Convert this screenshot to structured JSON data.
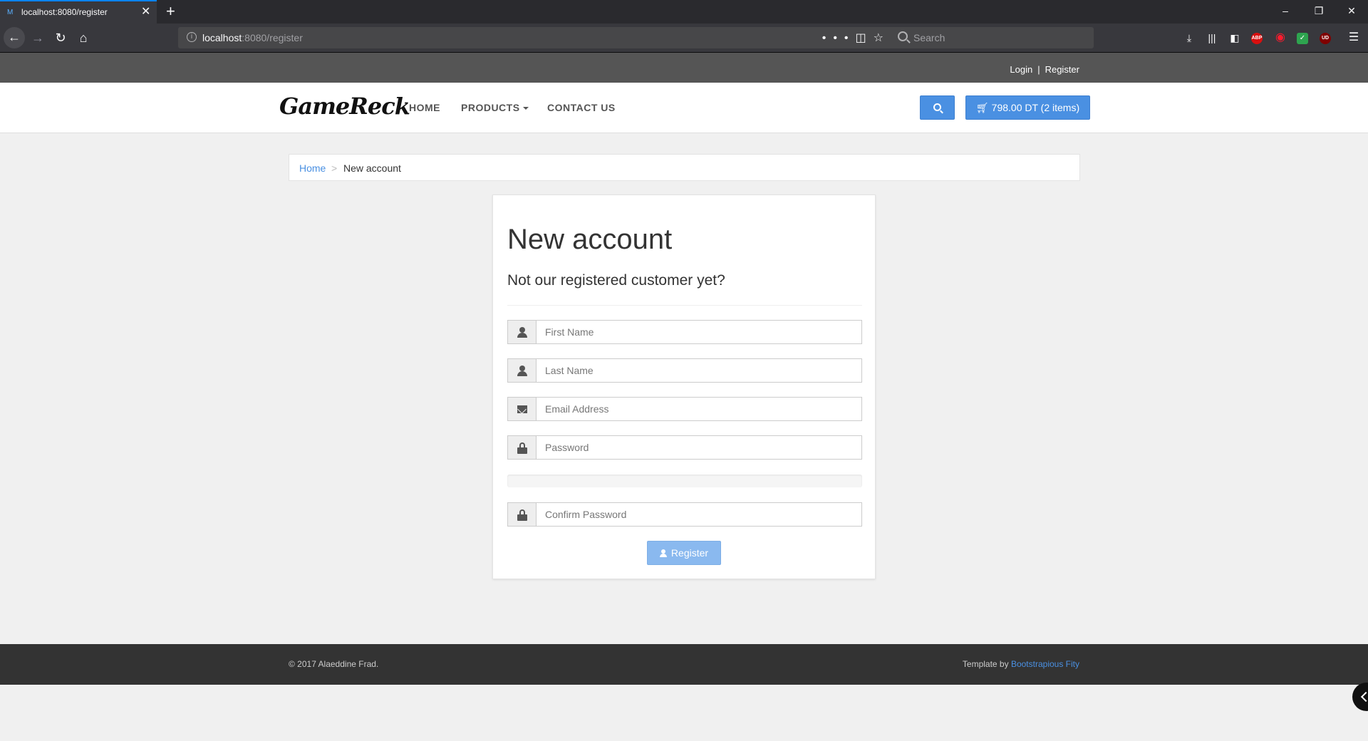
{
  "browser": {
    "tab_title": "localhost:8080/register",
    "url_host": "localhost",
    "url_rest": ":8080/register",
    "search_placeholder": "Search",
    "icons": [
      "back-icon",
      "forward-icon",
      "reload-icon",
      "home-icon",
      "page-actions-icon",
      "pocket-icon",
      "bookmark-star-icon",
      "download-icon",
      "library-icon",
      "sidebar-icon",
      "adblock-icon",
      "opera-icon",
      "shield-icon",
      "ublock-icon",
      "menu-icon"
    ],
    "adblock_badge": "ABP",
    "ublock_badge": "UD"
  },
  "topbar": {
    "login": "Login",
    "separator": "|",
    "register": "Register"
  },
  "nav": {
    "logo": "GameReck",
    "home": "HOME",
    "products": "PRODUCTS",
    "contact": "CONTACT US",
    "cart": "798.00 DT (2 items)"
  },
  "breadcrumb": {
    "home": "Home",
    "separator": ">",
    "current": "New account"
  },
  "form": {
    "title": "New account",
    "subtitle": "Not our registered customer yet?",
    "first_name_placeholder": "First Name",
    "last_name_placeholder": "Last Name",
    "email_placeholder": "Email Address",
    "password_placeholder": "Password",
    "confirm_password_placeholder": "Confirm Password",
    "password_strength": 0,
    "register_button": "Register"
  },
  "footer": {
    "copyright": "© 2017 Alaeddine Frad.",
    "template_by": "Template by ",
    "template_link": "Bootstrapious Fity"
  },
  "colors": {
    "accent": "#4a90e2",
    "topbar": "#555555",
    "footer": "#333333",
    "register_button": "#8ab9ef"
  }
}
